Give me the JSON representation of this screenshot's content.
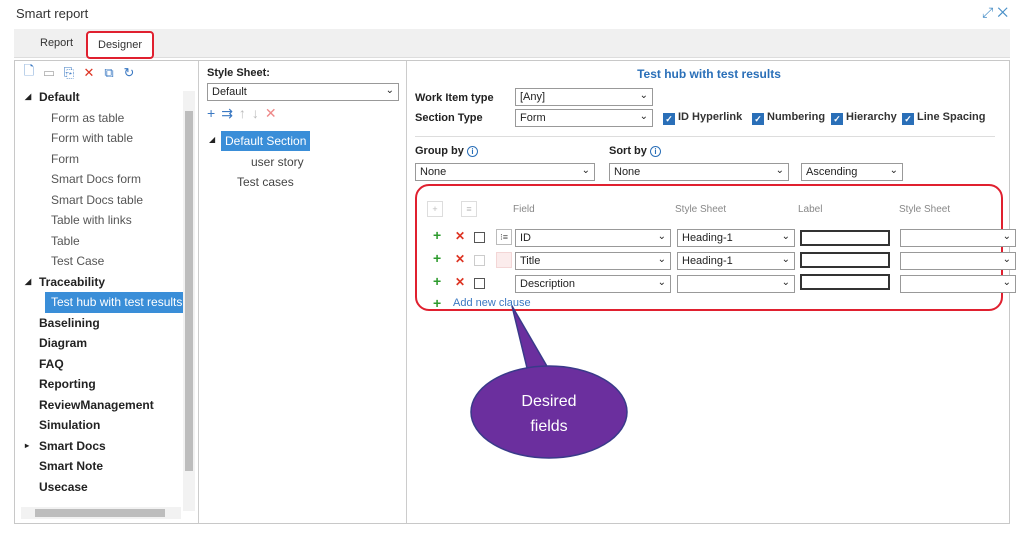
{
  "window": {
    "title": "Smart report",
    "expand_icon": "expand-icon",
    "close_icon": "close-icon"
  },
  "tabs": [
    {
      "label": "Report"
    },
    {
      "label": "Designer"
    }
  ],
  "left_toolbar": {
    "icons": [
      "add-document-icon",
      "save-icon",
      "save-as-icon",
      "delete-icon",
      "copy-icon",
      "refresh-icon"
    ]
  },
  "tree": {
    "groups": [
      {
        "label": "Default",
        "items": [
          "Form as table",
          "Form with table",
          "Form",
          "Smart Docs form",
          "Smart Docs table",
          "Table with links",
          "Table",
          "Test Case"
        ]
      },
      {
        "label": "Traceability",
        "items": [
          "Test hub with test results"
        ]
      },
      {
        "label": "Baselining"
      },
      {
        "label": "Diagram"
      },
      {
        "label": "FAQ"
      },
      {
        "label": "Reporting"
      },
      {
        "label": "ReviewManagement"
      },
      {
        "label": "Simulation"
      },
      {
        "label": "Smart Docs"
      },
      {
        "label": "Smart Note"
      },
      {
        "label": "Usecase"
      }
    ]
  },
  "style_sheet": {
    "label": "Style Sheet:",
    "value": "Default"
  },
  "sections": {
    "root": "Default Section",
    "children": [
      "user story",
      "Test cases"
    ]
  },
  "designer": {
    "title": "Test hub with test results",
    "work_item_type": {
      "label": "Work Item type",
      "value": "[Any]"
    },
    "section_type": {
      "label": "Section Type",
      "value": "Form"
    },
    "checkboxes": [
      {
        "label": "ID Hyperlink",
        "checked": true
      },
      {
        "label": "Numbering",
        "checked": true
      },
      {
        "label": "Hierarchy",
        "checked": true
      },
      {
        "label": "Line Spacing",
        "checked": true
      }
    ],
    "group_by": {
      "label": "Group by",
      "value": "None"
    },
    "sort_by": {
      "label": "Sort by",
      "value": "None",
      "order": "Ascending"
    },
    "columns": {
      "field": "Field",
      "style_sheet": "Style Sheet",
      "label": "Label",
      "style_sheet2": "Style Sheet"
    },
    "rows": [
      {
        "field": "ID",
        "style": "Heading-1",
        "label": "",
        "style2": ""
      },
      {
        "field": "Title",
        "style": "Heading-1",
        "label": "",
        "style2": ""
      },
      {
        "field": "Description",
        "style": "",
        "label": "",
        "style2": ""
      }
    ],
    "add_clause": "Add new clause"
  },
  "callout": {
    "line1": "Desired",
    "line2": "fields",
    "fill": "#6b2f9e"
  },
  "colors": {
    "highlight": "#e0202f",
    "accent": "#2a6fb8",
    "selection": "#3a8ed8"
  }
}
